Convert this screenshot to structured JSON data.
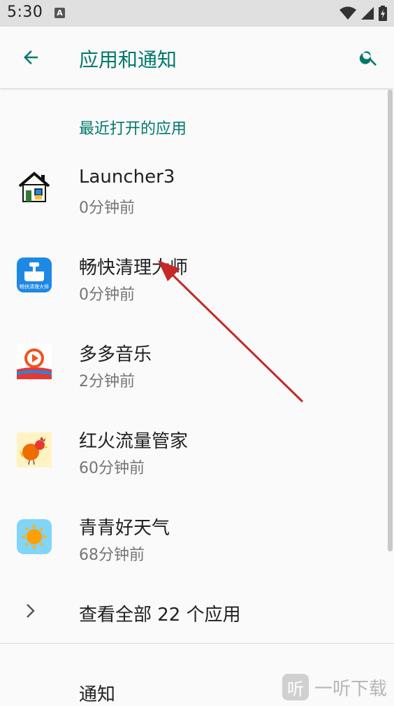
{
  "status_bar": {
    "time": "5:30",
    "a_icon": "A"
  },
  "app_bar": {
    "title": "应用和通知"
  },
  "section_header": "最近打开的应用",
  "apps": [
    {
      "name": "Launcher3",
      "time": "0分钟前",
      "icon": "house-icon"
    },
    {
      "name": "畅快清理大师",
      "time": "0分钟前",
      "icon": "cleaner-icon",
      "icon_caption": "畅快清理大师"
    },
    {
      "name": "多多音乐",
      "time": "2分钟前",
      "icon": "music-play-icon"
    },
    {
      "name": "红火流量管家",
      "time": "60分钟前",
      "icon": "rooster-icon"
    },
    {
      "name": "青青好天气",
      "time": "68分钟前",
      "icon": "sun-icon"
    }
  ],
  "see_all": "查看全部 22 个应用",
  "notifications_label": "通知",
  "watermark": {
    "badge": "听",
    "text": "一听下载"
  },
  "colors": {
    "accent": "#00796b",
    "arrow": "#c62828"
  }
}
